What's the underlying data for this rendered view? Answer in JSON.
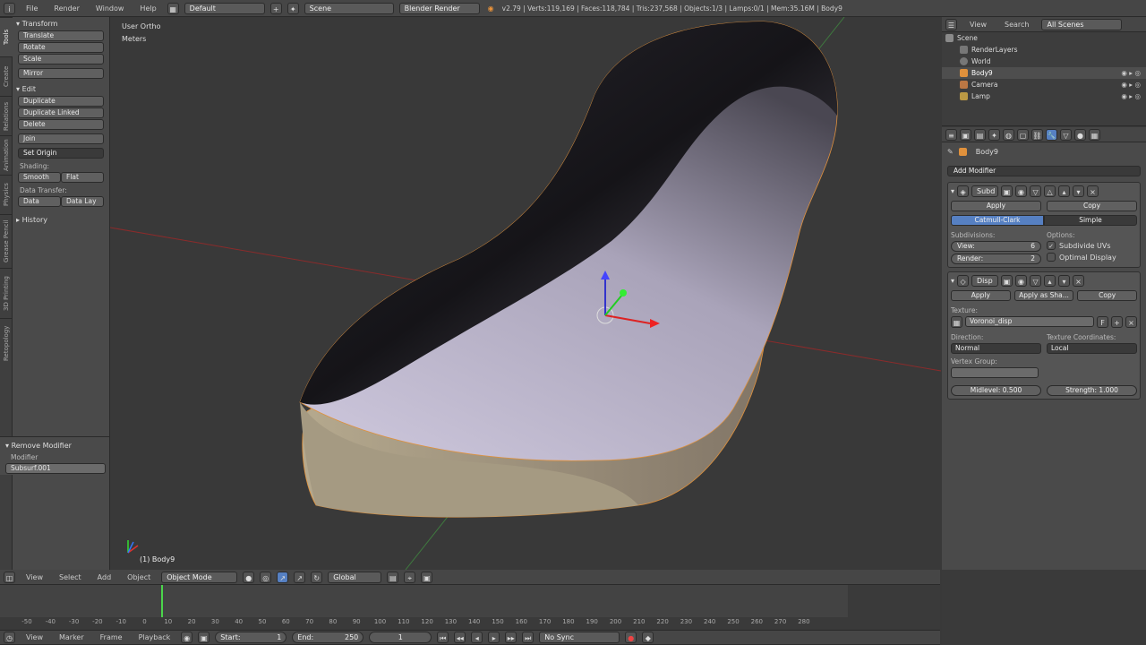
{
  "topbar": {
    "menus": [
      "File",
      "Render",
      "Window",
      "Help"
    ],
    "layout": "Default",
    "scene": "Scene",
    "engine": "Blender Render",
    "stats": "v2.79 | Verts:119,169 | Faces:118,784 | Tris:237,568 | Objects:1/3 | Lamps:0/1 | Mem:35.16M | Body9"
  },
  "viewport": {
    "view_label": "User Ortho",
    "units_label": "Meters",
    "object_label": "(1) Body9"
  },
  "toolshelf": {
    "tabs": [
      "Tools",
      "Create",
      "Relations",
      "Animation",
      "Physics",
      "Grease Pencil",
      "3D Printing",
      "Retopology"
    ],
    "transform_header": "Transform",
    "transform_buttons": [
      "Translate",
      "Rotate",
      "Scale",
      "Mirror"
    ],
    "edit_header": "Edit",
    "edit_buttons": [
      "Duplicate",
      "Duplicate Linked",
      "Delete",
      "Join"
    ],
    "set_origin": "Set Origin",
    "shading_label": "Shading:",
    "shading_buttons": [
      "Smooth",
      "Flat"
    ],
    "data_transfer_label": "Data Transfer:",
    "data_buttons": [
      "Data",
      "Data Lay"
    ],
    "history_header": "History",
    "remove_modifier_header": "Remove Modifier",
    "modifier_label": "Modifier",
    "modifier_value": "Subsurf.001"
  },
  "outliner": {
    "menus": [
      "View",
      "Search"
    ],
    "filter": "All Scenes",
    "items": [
      "Scene",
      "RenderLayers",
      "World",
      "Body9",
      "Camera",
      "Lamp"
    ]
  },
  "properties": {
    "object_name": "Body9",
    "add_modifier": "Add Modifier",
    "subsurf": {
      "name": "Subd",
      "apply": "Apply",
      "copy": "Copy",
      "tabs": [
        "Catmull-Clark",
        "Simple"
      ],
      "subdivisions_label": "Subdivisions:",
      "view_label": "View:",
      "view_value": "6",
      "render_label": "Render:",
      "render_value": "2",
      "options_label": "Options:",
      "opt1": "Subdivide UVs",
      "opt2": "Optimal Display"
    },
    "displace": {
      "name": "Disp",
      "apply": "Apply",
      "apply_shape": "Apply as Sha...",
      "copy": "Copy",
      "texture_label": "Texture:",
      "texture_value": "Voronoi_disp",
      "direction_label": "Direction:",
      "direction_value": "Normal",
      "coords_label": "Texture Coordinates:",
      "coords_value": "Local",
      "vgroup_label": "Vertex Group:",
      "midlevel": "Midlevel:  0.500",
      "strength": "Strength:  1.000"
    }
  },
  "viewbar": {
    "menus": [
      "View",
      "Select",
      "Add",
      "Object"
    ],
    "mode": "Object Mode",
    "orientation": "Global"
  },
  "timeline": {
    "ticks": [
      "-50",
      "-40",
      "-30",
      "-20",
      "-10",
      "0",
      "10",
      "20",
      "30",
      "40",
      "50",
      "60",
      "70",
      "80",
      "90",
      "100",
      "110",
      "120",
      "130",
      "140",
      "150",
      "160",
      "170",
      "180",
      "190",
      "200",
      "210",
      "220",
      "230",
      "240",
      "250",
      "260",
      "270",
      "280"
    ],
    "current_frame": 0
  },
  "tlbar": {
    "menus": [
      "View",
      "Marker",
      "Frame",
      "Playback"
    ],
    "start": "Start:",
    "start_value": "1",
    "end": "End:",
    "end_value": "250",
    "current": "1",
    "sync": "No Sync"
  }
}
